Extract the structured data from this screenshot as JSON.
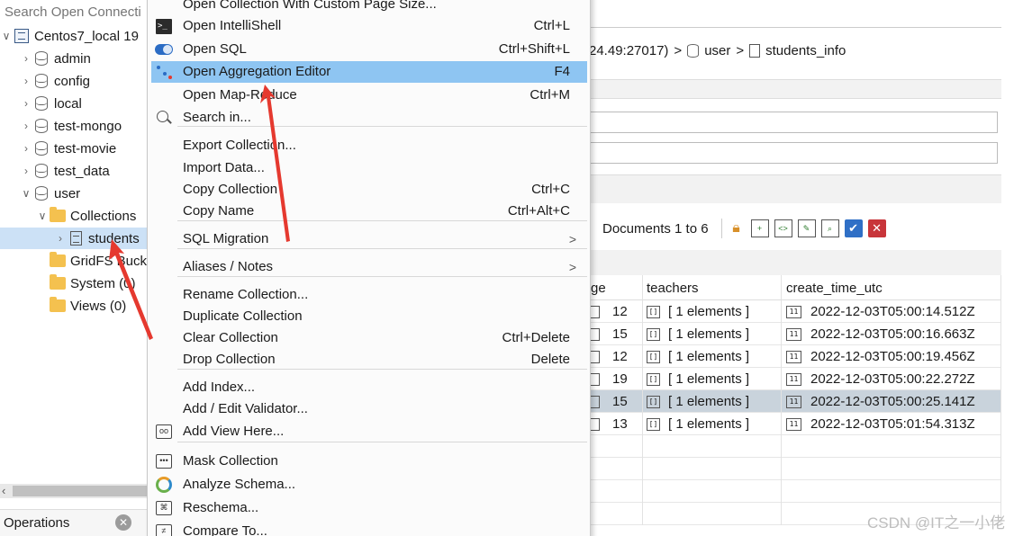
{
  "tree": {
    "search_placeholder": "Search Open Connecti",
    "connection": "Centos7_local 19",
    "databases": [
      "admin",
      "config",
      "local",
      "test-mongo",
      "test-movie",
      "test_data",
      "user"
    ],
    "collections_folder": "Collections",
    "selected_collection": "students",
    "gridfs": "GridFS Buck",
    "system": "System (0)",
    "views": "Views (0)"
  },
  "operations": {
    "label": "Operations",
    "close_icon": "close-icon"
  },
  "breadcrumb": {
    "host": "24.49:27017)",
    "sep1": ">",
    "database": "user",
    "sep2": ">",
    "collection": "students_info"
  },
  "toolbar": {
    "documents_label": "Documents 1 to 6"
  },
  "grid": {
    "headers": [
      "ge",
      "teachers",
      "create_time_utc"
    ],
    "rows": [
      {
        "age": "12",
        "teachers": "[ 1 elements ]",
        "time": "2022-12-03T05:00:14.512Z"
      },
      {
        "age": "15",
        "teachers": "[ 1 elements ]",
        "time": "2022-12-03T05:00:16.663Z"
      },
      {
        "age": "12",
        "teachers": "[ 1 elements ]",
        "time": "2022-12-03T05:00:19.456Z"
      },
      {
        "age": "19",
        "teachers": "[ 1 elements ]",
        "time": "2022-12-03T05:00:22.272Z"
      },
      {
        "age": "15",
        "teachers": "[ 1 elements ]",
        "time": "2022-12-03T05:00:25.141Z"
      },
      {
        "age": "13",
        "teachers": "[ 1 elements ]",
        "time": "2022-12-03T05:01:54.313Z"
      }
    ],
    "selected_row": 4
  },
  "menu": {
    "items": [
      {
        "label": "Open Collection With Custom Page Size...",
        "shortcut": ""
      },
      {
        "label": "Open IntelliShell",
        "shortcut": "Ctrl+L"
      },
      {
        "label": "Open SQL",
        "shortcut": "Ctrl+Shift+L"
      },
      {
        "label": "Open Aggregation Editor",
        "shortcut": "F4"
      },
      {
        "label": "Open Map-Reduce",
        "shortcut": "Ctrl+M"
      },
      {
        "label": "Search in...",
        "shortcut": ""
      },
      {
        "label": "Export Collection...",
        "shortcut": ""
      },
      {
        "label": "Import Data...",
        "shortcut": ""
      },
      {
        "label": "Copy Collection",
        "shortcut": "Ctrl+C"
      },
      {
        "label": "Copy Name",
        "shortcut": "Ctrl+Alt+C"
      },
      {
        "label": "SQL Migration",
        "shortcut": ""
      },
      {
        "label": "Aliases / Notes",
        "shortcut": ""
      },
      {
        "label": "Rename Collection...",
        "shortcut": ""
      },
      {
        "label": "Duplicate Collection",
        "shortcut": ""
      },
      {
        "label": "Clear Collection",
        "shortcut": "Ctrl+Delete"
      },
      {
        "label": "Drop Collection",
        "shortcut": "Delete"
      },
      {
        "label": "Add Index...",
        "shortcut": ""
      },
      {
        "label": "Add / Edit Validator...",
        "shortcut": ""
      },
      {
        "label": "Add View Here...",
        "shortcut": ""
      },
      {
        "label": "Mask Collection",
        "shortcut": ""
      },
      {
        "label": "Analyze Schema...",
        "shortcut": ""
      },
      {
        "label": "Reschema...",
        "shortcut": ""
      },
      {
        "label": "Compare To...",
        "shortcut": ""
      }
    ],
    "highlighted_index": 3,
    "submenu_glyph": ">",
    "shell_glyph": ">_"
  },
  "watermark": "CSDN @IT之一小佬",
  "colors": {
    "menu_highlight": "#8ec5f2",
    "tree_selection": "#cce1f6",
    "annotation_arrow": "#e5392f"
  }
}
